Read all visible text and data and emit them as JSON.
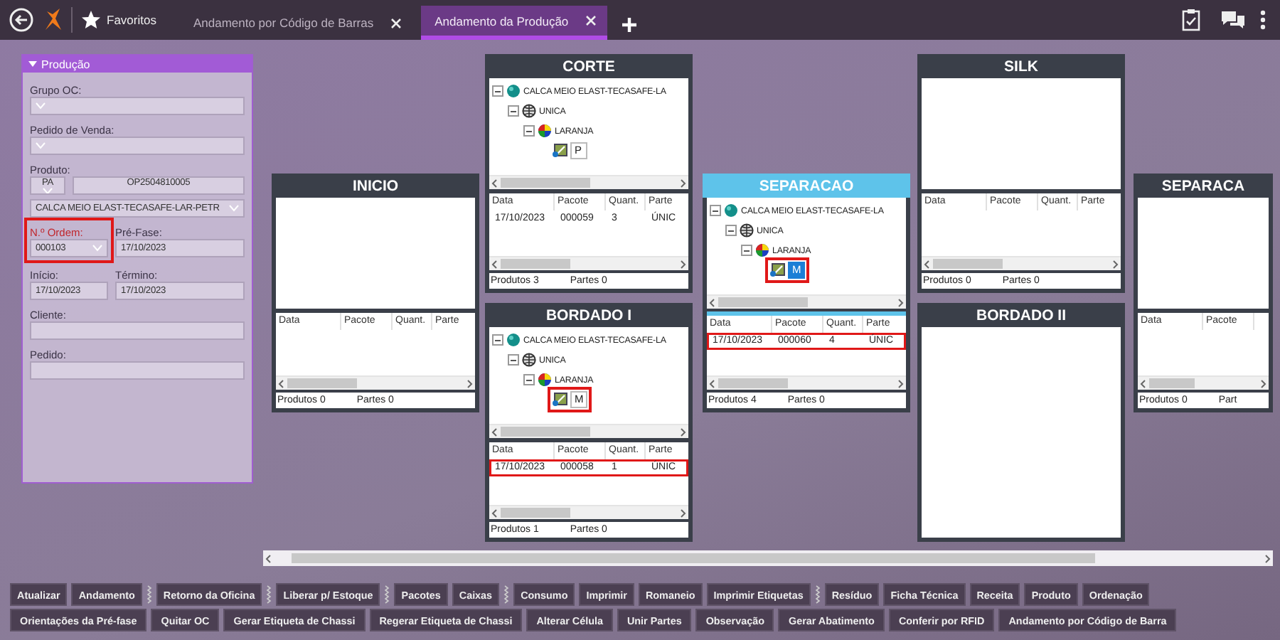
{
  "topbar": {
    "favorites": "Favoritos",
    "tabs": [
      {
        "label": "Andamento por Código de Barras",
        "selected": false
      },
      {
        "label": "Andamento da Produção",
        "selected": true
      }
    ]
  },
  "panel": {
    "title": "Produção",
    "expanded": true,
    "grupo_oc": {
      "label": "Grupo OC:"
    },
    "pedido_venda": {
      "label": "Pedido de Venda:"
    },
    "produto": {
      "label": "Produto:",
      "type": "PA",
      "code": "OP2504810005",
      "description": "CALCA MEIO ELAST-TECASAFE-LAR-PETR"
    },
    "ordem": {
      "label": "N.º Ordem:",
      "value": "000103",
      "required": true,
      "marked": true
    },
    "pre_fase": {
      "label": "Pré-Fase:",
      "value": "17/10/2023"
    },
    "inicio": {
      "label": "Início:",
      "value": "17/10/2023"
    },
    "termino": {
      "label": "Término:",
      "value": "17/10/2023"
    },
    "cliente": {
      "label": "Cliente:"
    },
    "pedido": {
      "label": "Pedido:"
    }
  },
  "stages": [
    {
      "title": "INICIO",
      "active": false,
      "columns": [
        "Data",
        "Pacote",
        "Quant.",
        "Parte"
      ],
      "footer": [
        {
          "label": "Produtos",
          "value": "0"
        },
        {
          "label": "Partes",
          "value": "0"
        }
      ]
    },
    {
      "title": "CORTE",
      "active": false,
      "tree": [
        {
          "kind": "product",
          "label": "CALCA MEIO ELAST-TECASAFE-LA",
          "expanded": true,
          "children": [
            {
              "kind": "size",
              "label": "UNICA",
              "expanded": true,
              "children": [
                {
                  "kind": "color",
                  "label": "LARANJA",
                  "expanded": true,
                  "children": [
                    {
                      "kind": "part",
                      "label": "P",
                      "selected": false,
                      "marked": false
                    }
                  ]
                }
              ]
            }
          ]
        }
      ],
      "columns": [
        "Data",
        "Pacote",
        "Quant.",
        "Parte"
      ],
      "rows": [
        {
          "cells": [
            "17/10/2023",
            "000059",
            "3",
            "ÚNIC"
          ],
          "marked": false
        }
      ],
      "footer": [
        {
          "label": "Produtos",
          "value": "3"
        },
        {
          "label": "Partes",
          "value": "0"
        }
      ]
    },
    {
      "title": "BORDADO I",
      "active": false,
      "tree": [
        {
          "kind": "product",
          "label": "CALCA MEIO ELAST-TECASAFE-LA",
          "expanded": true,
          "children": [
            {
              "kind": "size",
              "label": "UNICA",
              "expanded": true,
              "children": [
                {
                  "kind": "color",
                  "label": "LARANJA",
                  "expanded": true,
                  "children": [
                    {
                      "kind": "part",
                      "label": "M",
                      "selected": false,
                      "marked": true
                    }
                  ]
                }
              ]
            }
          ]
        }
      ],
      "columns": [
        "Data",
        "Pacote",
        "Quant.",
        "Parte"
      ],
      "rows": [
        {
          "cells": [
            "17/10/2023",
            "000058",
            "1",
            "ÚNIC"
          ],
          "marked": true
        }
      ],
      "footer": [
        {
          "label": "Produtos",
          "value": "1"
        },
        {
          "label": "Partes",
          "value": "0"
        }
      ]
    },
    {
      "title": "SEPARACAO",
      "active": true,
      "tree": [
        {
          "kind": "product",
          "label": "CALCA MEIO ELAST-TECASAFE-LA",
          "expanded": true,
          "children": [
            {
              "kind": "size",
              "label": "UNICA",
              "expanded": true,
              "children": [
                {
                  "kind": "color",
                  "label": "LARANJA",
                  "expanded": true,
                  "children": [
                    {
                      "kind": "part",
                      "label": "M",
                      "selected": true,
                      "marked": true
                    }
                  ]
                }
              ]
            }
          ]
        }
      ],
      "columns": [
        "Data",
        "Pacote",
        "Quant.",
        "Parte"
      ],
      "rows": [
        {
          "cells": [
            "17/10/2023",
            "000060",
            "4",
            "ÚNIC"
          ],
          "marked": true
        }
      ],
      "footer": [
        {
          "label": "Produtos",
          "value": "4"
        },
        {
          "label": "Partes",
          "value": "0"
        }
      ]
    },
    {
      "title": "SILK",
      "active": false,
      "columns": [
        "Data",
        "Pacote",
        "Quant.",
        "Parte"
      ],
      "footer": [
        {
          "label": "Produtos",
          "value": "0"
        },
        {
          "label": "Partes",
          "value": "0"
        }
      ]
    },
    {
      "title": "BORDADO II",
      "active": false
    },
    {
      "title": "SEPARACA",
      "active": false,
      "columns": [
        "Data",
        "Pacote"
      ],
      "footer": [
        {
          "label": "Produtos",
          "value": "0"
        },
        {
          "label": "Part"
        }
      ]
    }
  ],
  "toolbar": [
    [
      {
        "kind": "button",
        "label": "Atualizar"
      },
      {
        "kind": "button",
        "label": "Andamento"
      },
      {
        "kind": "grip"
      },
      {
        "kind": "button",
        "label": "Retorno da Oficina"
      },
      {
        "kind": "grip"
      },
      {
        "kind": "button",
        "label": "Liberar p/ Estoque"
      },
      {
        "kind": "grip"
      },
      {
        "kind": "button",
        "label": "Pacotes"
      },
      {
        "kind": "button",
        "label": "Caixas"
      },
      {
        "kind": "grip"
      },
      {
        "kind": "button",
        "label": "Consumo"
      },
      {
        "kind": "button",
        "label": "Imprimir"
      },
      {
        "kind": "button",
        "label": "Romaneio"
      },
      {
        "kind": "button",
        "label": "Imprimir Etiquetas"
      },
      {
        "kind": "grip"
      },
      {
        "kind": "button",
        "label": "Resíduo"
      },
      {
        "kind": "button",
        "label": "Ficha Técnica"
      },
      {
        "kind": "button",
        "label": "Receita"
      },
      {
        "kind": "button",
        "label": "Produto"
      },
      {
        "kind": "button",
        "label": "Ordenação"
      }
    ],
    [
      {
        "kind": "button",
        "label": "Orientações da Pré-fase"
      },
      {
        "kind": "button",
        "label": "Quitar OC"
      },
      {
        "kind": "button",
        "label": "Gerar Etiqueta de Chassi"
      },
      {
        "kind": "button",
        "label": "Regerar Etiqueta de Chassi"
      },
      {
        "kind": "button",
        "label": "Alterar Célula"
      },
      {
        "kind": "button",
        "label": "Unir Partes"
      },
      {
        "kind": "button",
        "label": "Observação"
      },
      {
        "kind": "button",
        "label": "Gerar Abatimento"
      },
      {
        "kind": "button",
        "label": "Conferir por RFID"
      },
      {
        "kind": "button",
        "label": "Andamento por Código de Barra"
      }
    ]
  ]
}
